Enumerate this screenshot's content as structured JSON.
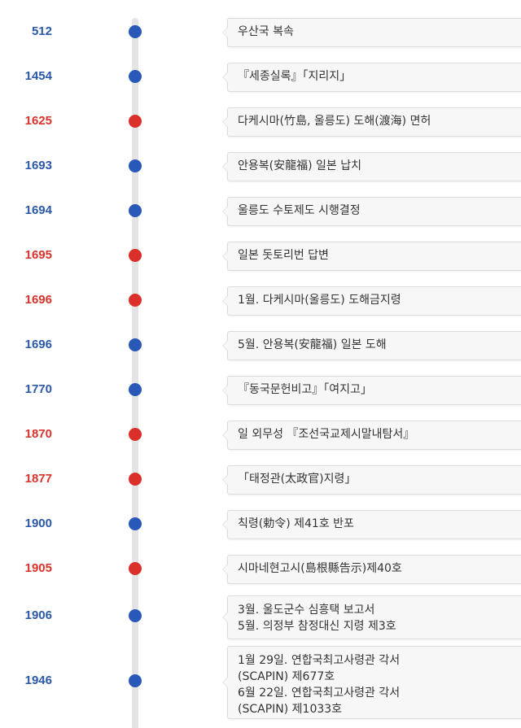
{
  "events": [
    {
      "year": "512",
      "tone": "blue",
      "lines": [
        "우산국 복속"
      ]
    },
    {
      "year": "1454",
      "tone": "blue",
      "lines": [
        "『세종실록』「지리지」"
      ]
    },
    {
      "year": "1625",
      "tone": "red",
      "lines": [
        "다케시마(竹島, 울릉도) 도해(渡海) 면허"
      ]
    },
    {
      "year": "1693",
      "tone": "blue",
      "lines": [
        "안용복(安龍福) 일본 납치"
      ]
    },
    {
      "year": "1694",
      "tone": "blue",
      "lines": [
        "울릉도 수토제도 시행결정"
      ]
    },
    {
      "year": "1695",
      "tone": "red",
      "lines": [
        "일본 돗토리번 답변"
      ]
    },
    {
      "year": "1696",
      "tone": "red",
      "lines": [
        "1월. 다케시마(울릉도) 도해금지령"
      ]
    },
    {
      "year": "1696",
      "tone": "blue",
      "lines": [
        "5월. 안용복(安龍福) 일본 도해"
      ]
    },
    {
      "year": "1770",
      "tone": "blue",
      "lines": [
        "『동국문헌비고』「여지고」"
      ]
    },
    {
      "year": "1870",
      "tone": "red",
      "lines": [
        "일 외무성 『조선국교제시말내탐서』"
      ]
    },
    {
      "year": "1877",
      "tone": "red",
      "lines": [
        "「태정관(太政官)지령」"
      ]
    },
    {
      "year": "1900",
      "tone": "blue",
      "lines": [
        "칙령(勅令) 제41호 반포"
      ]
    },
    {
      "year": "1905",
      "tone": "red",
      "lines": [
        "시마네현고시(島根縣告示)제40호"
      ]
    },
    {
      "year": "1906",
      "tone": "blue",
      "lines": [
        "3월. 울도군수 심흥택 보고서",
        "5월. 의정부 참정대신 지령 제3호"
      ]
    },
    {
      "year": "1946",
      "tone": "blue",
      "lines": [
        "1월 29일. 연합국최고사령관 각서",
        "(SCAPIN) 제677호",
        "6월 22일. 연합국최고사령관 각서",
        "(SCAPIN) 제1033호"
      ]
    }
  ],
  "colors": {
    "blue": "#2859b8",
    "red": "#db2f2a",
    "axis": "#e4e4e4",
    "card_bg": "#f7f7f7",
    "card_border": "#dcdcdc",
    "text": "#333333"
  }
}
